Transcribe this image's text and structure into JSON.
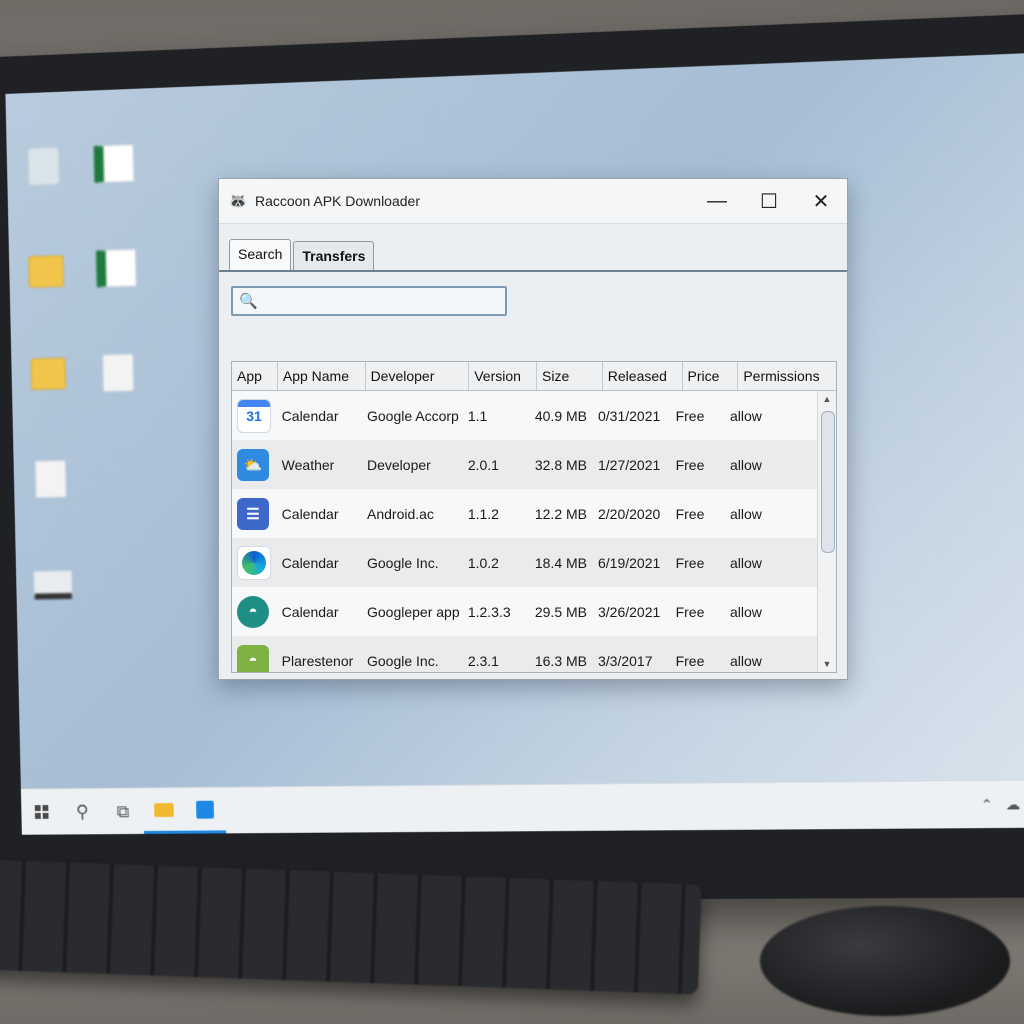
{
  "window": {
    "title": "Raccoon APK Downloader",
    "controls": {
      "minimize": "—",
      "maximize": "☐",
      "close": "✕"
    }
  },
  "tabs": [
    {
      "label": "Search",
      "active": true
    },
    {
      "label": "Transfers",
      "active": false
    }
  ],
  "search": {
    "value": "",
    "icon": "search-icon"
  },
  "table": {
    "headers": [
      "App",
      "App Name",
      "Developer",
      "Version",
      "Size",
      "Released",
      "Price",
      "Permissions"
    ],
    "rows": [
      {
        "icon": "calendar-31-icon",
        "icon_text": "31",
        "name": "Calendar",
        "developer": "Google Accorp",
        "version": "1.1",
        "size": "40.9 MB",
        "released": "0/31/2021",
        "price": "Free",
        "permissions": "allow"
      },
      {
        "icon": "weather-icon",
        "icon_text": "",
        "name": "Weather",
        "developer": "Developer",
        "version": "2.0.1",
        "size": "32.8 MB",
        "released": "1/27/2021",
        "price": "Free",
        "permissions": "allow"
      },
      {
        "icon": "document-icon",
        "icon_text": "",
        "name": "Calendar",
        "developer": "Android.ac",
        "version": "1.1.2",
        "size": "12.2 MB",
        "released": "2/20/2020",
        "price": "Free",
        "permissions": "allow"
      },
      {
        "icon": "edge-browser-icon",
        "icon_text": "",
        "name": "Calendar",
        "developer": "Google Inc.",
        "version": "1.0.2",
        "size": "18.4 MB",
        "released": "6/19/2021",
        "price": "Free",
        "permissions": "allow"
      },
      {
        "icon": "android-teal-icon",
        "icon_text": "",
        "name": "Calendar",
        "developer": "Googleper app",
        "version": "1.2.3.3",
        "size": "29.5 MB",
        "released": "3/26/2021",
        "price": "Free",
        "permissions": "allow"
      },
      {
        "icon": "android-green-icon",
        "icon_text": "",
        "name": "Plarestenor",
        "developer": "Google Inc.",
        "version": "2.3.1",
        "size": "16.3 MB",
        "released": "3/3/2017",
        "price": "Free",
        "permissions": "allow"
      }
    ]
  },
  "colors": {
    "accent": "#1e88e5",
    "desktop": "#a6bdd4",
    "window_bg": "#eceff1"
  }
}
